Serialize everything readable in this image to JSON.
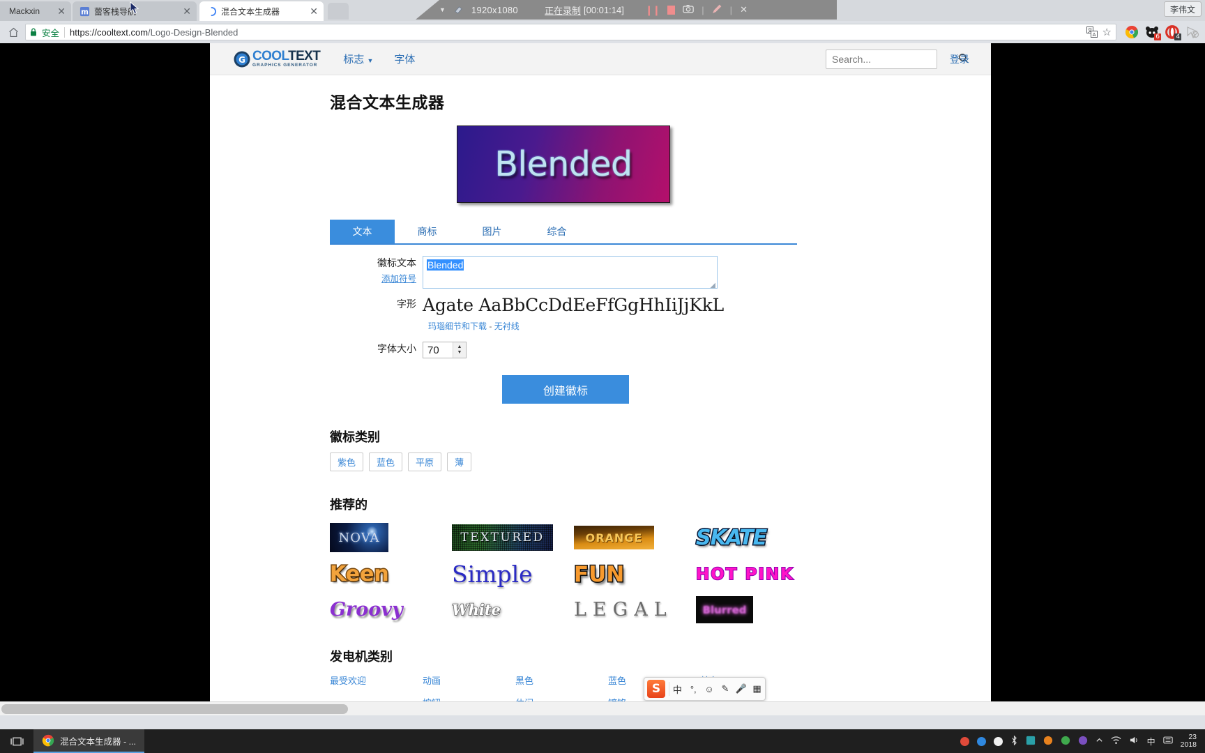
{
  "browser": {
    "tabs": [
      {
        "title": "Mackxin",
        "favicon": "none-icon",
        "active": false
      },
      {
        "title": "蕾客栈导航",
        "favicon": "m-square-icon",
        "active": false
      },
      {
        "title": "混合文本生成器",
        "favicon": "loading-spinner-icon",
        "active": true
      }
    ],
    "new_tab_label": "+",
    "omnibox": {
      "secure_label": "安全",
      "url_scheme": "https://",
      "url_host": "cooltext.com",
      "url_path": "/Logo-Design-Blended",
      "full_url": "https://cooltext.com/Logo-Design-Blended"
    },
    "user_chip": "李伟文",
    "extension_badges": [
      "6",
      "4"
    ]
  },
  "recorder": {
    "resolution": "1920x1080",
    "status": "正在录制",
    "timecode": "[00:01:14]",
    "buttons": [
      "pause-button",
      "stop-button",
      "camera-button",
      "pen-button",
      "close-button"
    ]
  },
  "site": {
    "logo": {
      "cool": "COOL",
      "text": "TEXT",
      "tagline": "GRAPHICS GENERATOR"
    },
    "nav": [
      {
        "label": "标志",
        "caret": "▼"
      },
      {
        "label": "字体",
        "caret": ""
      }
    ],
    "search": {
      "placeholder": "Search...",
      "value": ""
    },
    "login": "登录"
  },
  "main": {
    "title": "混合文本生成器",
    "preview_word": "Blended",
    "tabs": [
      {
        "label": "文本",
        "selected": true
      },
      {
        "label": "商标",
        "selected": false
      },
      {
        "label": "图片",
        "selected": false
      },
      {
        "label": "综合",
        "selected": false
      }
    ],
    "form": {
      "logo_text_label": "徽标文本",
      "add_symbol_link": "添加符号",
      "logo_text_value": "Blended",
      "font_label": "字形",
      "font_sample": "Agate AaBbCcDdEeFfGgHhIiJjKkL",
      "font_detail_link": "玛瑙细节和下载",
      "font_dash": "-",
      "font_style_link": "无衬线",
      "font_size_label": "字体大小",
      "font_size_value": "70",
      "spinner_up": "▲",
      "spinner_down": "▼",
      "create_button": "创建徽标"
    },
    "logo_category": {
      "heading": "徽标类别",
      "tags": [
        "紫色",
        "蓝色",
        "平原",
        "薄"
      ]
    },
    "featured": {
      "heading": "推荐的",
      "items": [
        [
          "NOVA",
          "TEXTURED",
          "ORANGE",
          "SKATE"
        ],
        [
          "Keen",
          "Simple",
          "FUN",
          "HOT PINK"
        ],
        [
          "Groovy",
          "White",
          "LEGAL",
          "Blurred"
        ]
      ]
    },
    "generator_category": {
      "heading": "发电机类别",
      "columns": [
        [
          "最受欢迎",
          ""
        ],
        [
          "动画",
          "按钮"
        ],
        [
          "黑色",
          "休闲"
        ],
        [
          "蓝色",
          "镀铬"
        ],
        [
          "棕色",
          ""
        ]
      ]
    }
  },
  "ime": {
    "brand": "S",
    "items": [
      "中",
      "°,",
      "☺",
      "✎",
      "🎤",
      "▦"
    ]
  },
  "taskbar": {
    "start_icon": "task-view-icon",
    "window_title": "混合文本生成器 - ...",
    "clock_line1": "23",
    "clock_line2": "2018"
  },
  "colors": {
    "accent": "#3a8ddd",
    "link": "#3a87d6",
    "secure_green": "#0b8043",
    "recorder_bg": "#8a8a8a"
  }
}
